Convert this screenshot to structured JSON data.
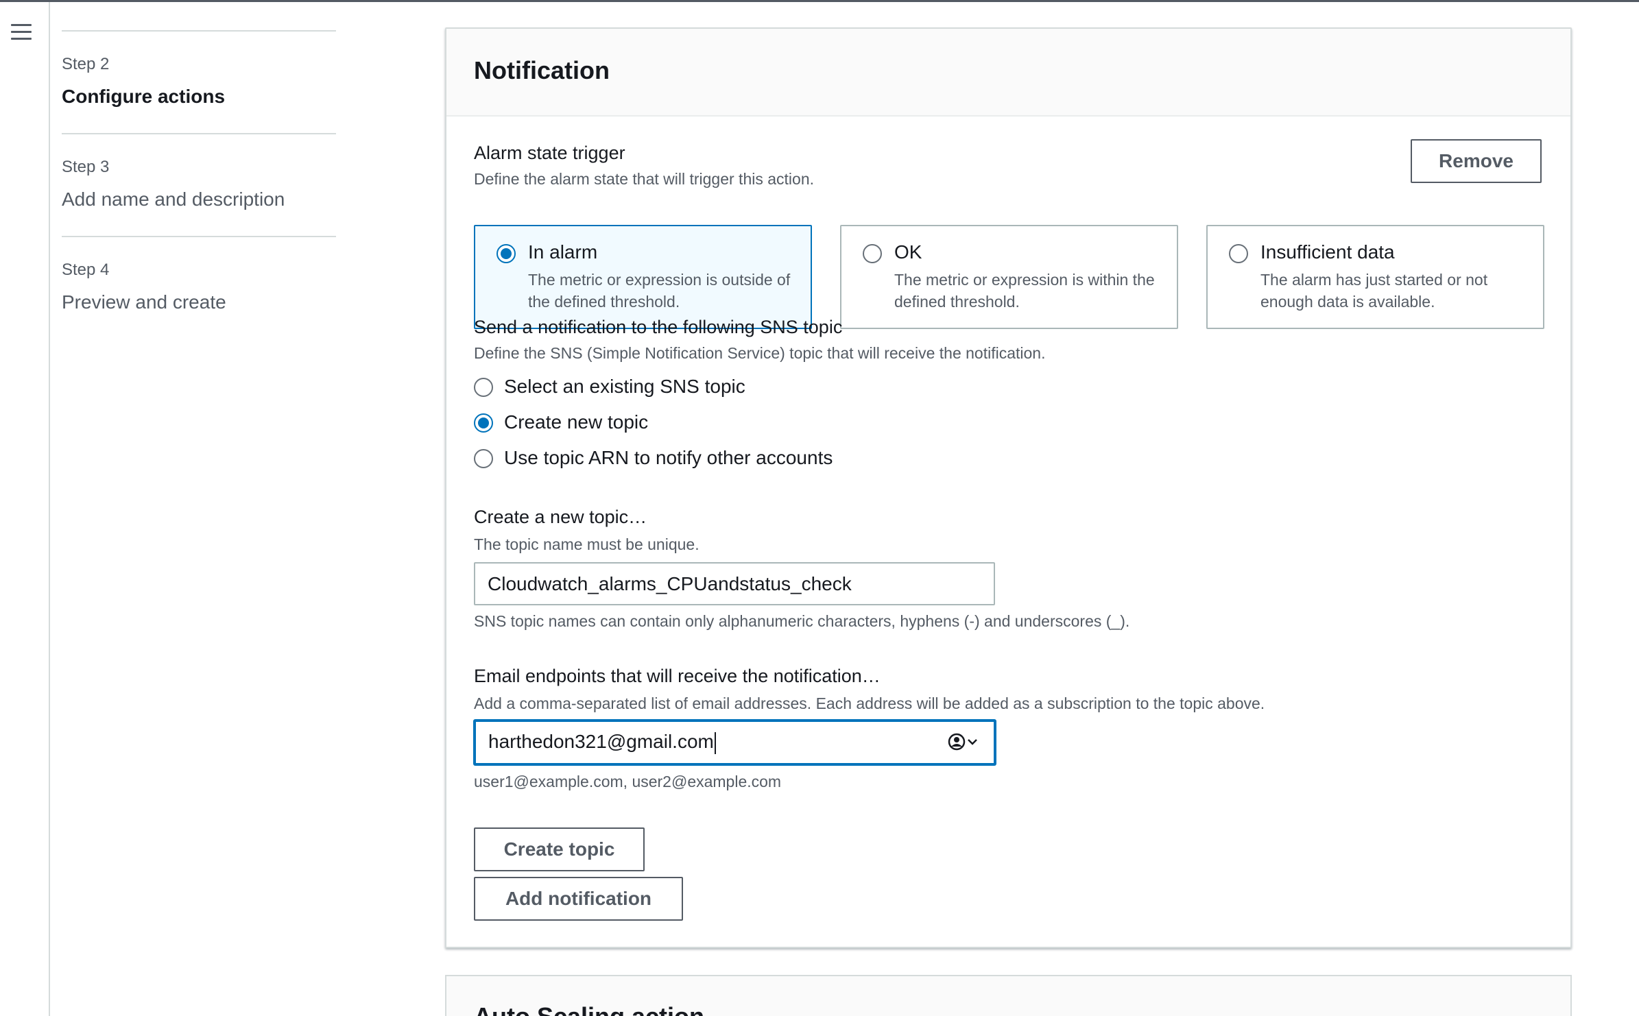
{
  "nav": {
    "menu_icon": "hamburger-menu-icon",
    "steps": [
      {
        "num": "Step 2",
        "title": "Configure actions",
        "active": true
      },
      {
        "num": "Step 3",
        "title": "Add name and description",
        "active": false
      },
      {
        "num": "Step 4",
        "title": "Preview and create",
        "active": false
      }
    ]
  },
  "notification": {
    "title": "Notification",
    "remove_label": "Remove",
    "alarm_state": {
      "label": "Alarm state trigger",
      "description": "Define the alarm state that will trigger this action.",
      "options": [
        {
          "title": "In alarm",
          "desc": "The metric or expression is outside of the defined threshold.",
          "selected": true
        },
        {
          "title": "OK",
          "desc": "The metric or expression is within the defined threshold.",
          "selected": false
        },
        {
          "title": "Insufficient data",
          "desc": "The alarm has just started or not enough data is available.",
          "selected": false
        }
      ]
    },
    "sns": {
      "label": "Send a notification to the following SNS topic",
      "description": "Define the SNS (Simple Notification Service) topic that will receive the notification.",
      "options": [
        {
          "label": "Select an existing SNS topic",
          "selected": false
        },
        {
          "label": "Create new topic",
          "selected": true
        },
        {
          "label": "Use topic ARN to notify other accounts",
          "selected": false
        }
      ]
    },
    "new_topic": {
      "label": "Create a new topic…",
      "description": "The topic name must be unique.",
      "value": "Cloudwatch_alarms_CPUandstatus_check",
      "constraint": "SNS topic names can contain only alphanumeric characters, hyphens (-) and underscores (_)."
    },
    "email": {
      "label": "Email endpoints that will receive the notification…",
      "description": "Add a comma-separated list of email addresses. Each address will be added as a subscription to the topic above.",
      "value": "harthedon321@gmail.com",
      "hint": "user1@example.com, user2@example.com",
      "autofill_icon": "contact-autofill-icon"
    },
    "create_topic_label": "Create topic",
    "add_notification_label": "Add notification"
  },
  "next_section": {
    "title": "Auto Scaling action"
  },
  "colors": {
    "accent": "#0073bb",
    "selected_tile_bg": "#f1faff",
    "text": "#16191f",
    "muted": "#545b64"
  }
}
